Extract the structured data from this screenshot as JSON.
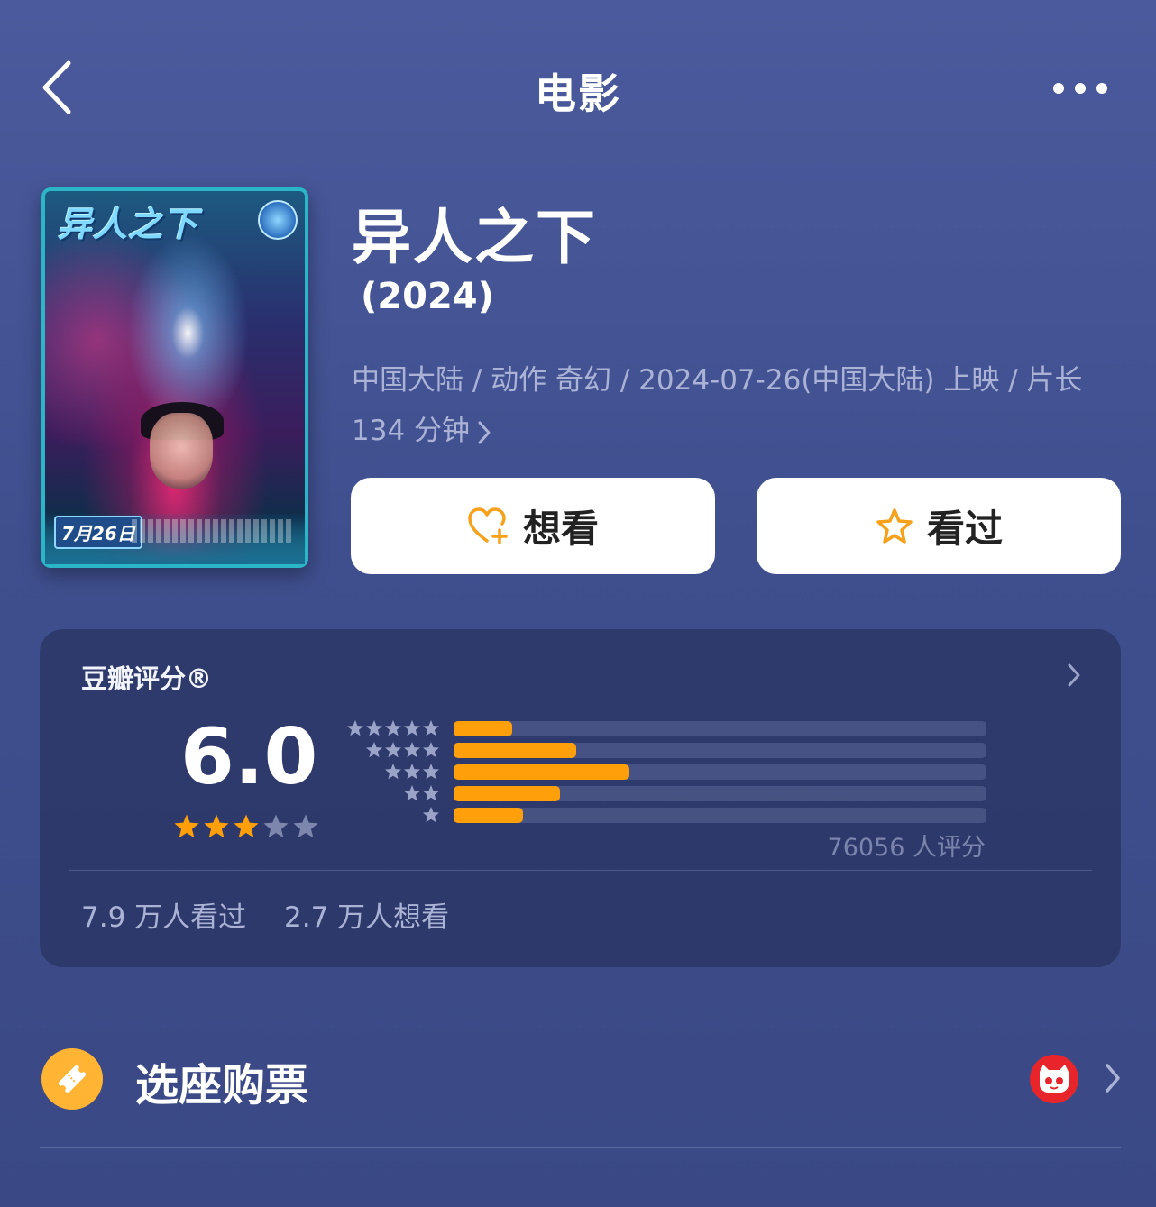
{
  "nav": {
    "title": "电影",
    "back_icon": "chevron-left-icon",
    "more_icon": "more-dots-icon"
  },
  "poster": {
    "title_text": "异人之下",
    "date_text": "7月26日"
  },
  "movie": {
    "title": "异人之下",
    "year": "(2024)",
    "meta_line": "中国大陆 / 动作 奇幻 / 2024-07-26(中国大陆) 上映 / 片长134 分钟"
  },
  "actions": {
    "want_label": "想看",
    "want_icon": "heart-plus-icon",
    "seen_label": "看过",
    "seen_icon": "star-outline-icon"
  },
  "rating": {
    "label": "豆瓣评分®",
    "score": "6.0",
    "stars_filled": 3,
    "stars_total": 5,
    "distribution": [
      {
        "stars": 5,
        "fraction": 0.11
      },
      {
        "stars": 4,
        "fraction": 0.23
      },
      {
        "stars": 3,
        "fraction": 0.33
      },
      {
        "stars": 2,
        "fraction": 0.2
      },
      {
        "stars": 1,
        "fraction": 0.13
      }
    ],
    "votes": "76056 人评分",
    "seen_count": "7.9 万人看过",
    "want_count": "2.7 万人想看"
  },
  "ticket": {
    "label": "选座购票",
    "icon": "ticket-icon",
    "provider_icon": "maoyan-cat-icon"
  },
  "colors": {
    "accent": "#ff9f0a",
    "star_filled": "#ff9f0a",
    "star_empty": "#7d86ad",
    "card_bg": "#2d3766",
    "ticket_icon_bg": "#ffb433",
    "provider_red": "#e8252b"
  }
}
